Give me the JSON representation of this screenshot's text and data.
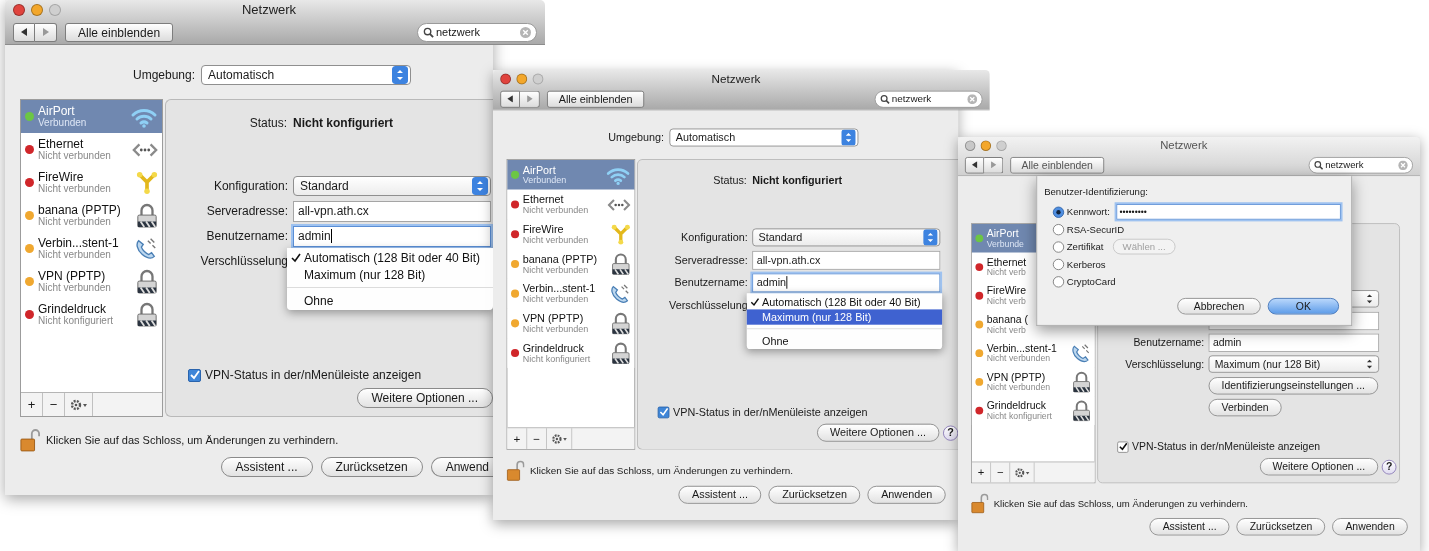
{
  "windows": [
    {
      "title": "Netzwerk",
      "active": true,
      "toolbar": {
        "show_all": "Alle einblenden",
        "search": "netzwerk"
      },
      "location": {
        "label": "Umgebung:",
        "value": "Automatisch"
      },
      "services": [
        {
          "name": "AirPort",
          "status": "Verbunden",
          "color": "#6cc644",
          "kind": "wifi",
          "selected": true
        },
        {
          "name": "Ethernet",
          "status": "Nicht verbunden",
          "color": "#d0262a",
          "kind": "ethernet",
          "selected": false
        },
        {
          "name": "FireWire",
          "status": "Nicht verbunden",
          "color": "#d0262a",
          "kind": "firewire",
          "selected": false
        },
        {
          "name": "banana (PPTP)",
          "status": "Nicht verbunden",
          "color": "#f0a830",
          "kind": "lock",
          "selected": false
        },
        {
          "name": "Verbin...stent-1",
          "status": "Nicht verbunden",
          "color": "#f0a830",
          "kind": "phone",
          "selected": false
        },
        {
          "name": "VPN (PPTP)",
          "status": "Nicht verbunden",
          "color": "#f0a830",
          "kind": "lock",
          "selected": false
        },
        {
          "name": "Grindeldruck",
          "status": "Nicht konfiguriert",
          "color": "#d0262a",
          "kind": "lock",
          "selected": false
        }
      ],
      "list_controls": [
        "+",
        "−"
      ],
      "status": {
        "label": "Status:",
        "value": "Nicht konfiguriert"
      },
      "form": [
        {
          "kind": "popup",
          "label": "Konfiguration:",
          "value": "Standard"
        },
        {
          "kind": "field",
          "label": "Serveradresse:",
          "value": "all-vpn.ath.cx",
          "focused": false
        },
        {
          "kind": "field",
          "label": "Benutzername:",
          "value": "admin",
          "focused": true
        },
        {
          "kind": "menu",
          "label": "Verschlüsselung",
          "options": [
            {
              "label": "Automatisch (128 Bit oder 40 Bit)",
              "checked": true,
              "selected": false,
              "separator_before": false
            },
            {
              "label": "Maximum (nur 128 Bit)",
              "checked": false,
              "selected": false,
              "separator_before": false
            },
            {
              "label": "Ohne",
              "checked": false,
              "selected": false,
              "separator_before": true
            }
          ]
        }
      ],
      "show_status": {
        "label": "VPN-Status in der/nMenüleiste anzeigen",
        "checked": true
      },
      "more_options": "Weitere Optionen ...",
      "lock_text": "Klicken Sie auf das Schloss, um Änderungen zu verhindern.",
      "buttons": [
        "Assistent ...",
        "Zurücksetzen",
        "Anwend"
      ]
    },
    {
      "title": "Netzwerk",
      "active": true,
      "toolbar": {
        "show_all": "Alle einblenden",
        "search": "netzwerk"
      },
      "location": {
        "label": "Umgebung:",
        "value": "Automatisch"
      },
      "services": [
        {
          "name": "AirPort",
          "status": "Verbunden",
          "color": "#6cc644",
          "kind": "wifi",
          "selected": true
        },
        {
          "name": "Ethernet",
          "status": "Nicht verbunden",
          "color": "#d0262a",
          "kind": "ethernet",
          "selected": false
        },
        {
          "name": "FireWire",
          "status": "Nicht verbunden",
          "color": "#d0262a",
          "kind": "firewire",
          "selected": false
        },
        {
          "name": "banana (PPTP)",
          "status": "Nicht verbunden",
          "color": "#f0a830",
          "kind": "lock",
          "selected": false
        },
        {
          "name": "Verbin...stent-1",
          "status": "Nicht verbunden",
          "color": "#f0a830",
          "kind": "phone",
          "selected": false
        },
        {
          "name": "VPN (PPTP)",
          "status": "Nicht verbunden",
          "color": "#f0a830",
          "kind": "lock",
          "selected": false
        },
        {
          "name": "Grindeldruck",
          "status": "Nicht konfiguriert",
          "color": "#d0262a",
          "kind": "lock",
          "selected": false
        }
      ],
      "list_controls": [
        "+",
        "−"
      ],
      "status": {
        "label": "Status:",
        "value": "Nicht konfiguriert"
      },
      "form": [
        {
          "kind": "popup",
          "label": "Konfiguration:",
          "value": "Standard"
        },
        {
          "kind": "field",
          "label": "Serveradresse:",
          "value": "all-vpn.ath.cx",
          "focused": false
        },
        {
          "kind": "field",
          "label": "Benutzername:",
          "value": "admin",
          "focused": true
        },
        {
          "kind": "menu",
          "label": "Verschlüsselung",
          "options": [
            {
              "label": "Automatisch (128 Bit oder 40 Bit)",
              "checked": true,
              "selected": false,
              "separator_before": false
            },
            {
              "label": "Maximum (nur 128 Bit)",
              "checked": false,
              "selected": true,
              "separator_before": false
            },
            {
              "label": "Ohne",
              "checked": false,
              "selected": false,
              "separator_before": true
            }
          ]
        }
      ],
      "show_status": {
        "label": "VPN-Status in der/nMenüleiste anzeigen",
        "checked": true
      },
      "more_options": "Weitere Optionen ...",
      "help": "?",
      "lock_text": "Klicken Sie auf das Schloss, um Änderungen zu verhindern.",
      "buttons": [
        "Assistent ...",
        "Zurücksetzen",
        "Anwenden"
      ]
    },
    {
      "title": "Netzwerk",
      "active": false,
      "toolbar": {
        "show_all": "Alle einblenden",
        "search": "netzwerk"
      },
      "services": [
        {
          "name": "AirPort",
          "status": "Verbunde",
          "color": "#6cc644",
          "selected": true
        },
        {
          "name": "Ethernet",
          "status": "Nicht verb",
          "color": "#d0262a",
          "selected": false
        },
        {
          "name": "FireWire",
          "status": "Nicht verb",
          "color": "#d0262a",
          "selected": false
        },
        {
          "name": "banana (",
          "status": "Nicht verb",
          "color": "#f0a830",
          "selected": false
        },
        {
          "name": "Verbin...stent-1",
          "status": "Nicht verbunden",
          "color": "#f0a830",
          "kind": "phone",
          "selected": false
        },
        {
          "name": "VPN (PPTP)",
          "status": "Nicht verbunden",
          "color": "#f0a830",
          "kind": "lock",
          "selected": false
        },
        {
          "name": "Grindeldruck",
          "status": "Nicht konfiguriert",
          "color": "#d0262a",
          "kind": "lock",
          "selected": false
        }
      ],
      "list_controls": [
        "+",
        "−"
      ],
      "form": [
        {
          "kind": "popup"
        },
        {
          "kind": "field",
          "focused": false
        },
        {
          "kind": "field",
          "label": "Benutzername:",
          "value": "admin",
          "focused": false
        },
        {
          "kind": "popup",
          "label": "Verschlüsselung:",
          "value": "Maximum (nur 128 Bit)"
        },
        {
          "kind": "button",
          "label": "Identifizierungseinstellungen ..."
        },
        {
          "kind": "button",
          "label": "Verbinden"
        }
      ],
      "show_status": {
        "label": "VPN-Status in der/nMenüleiste anzeigen",
        "checked": true
      },
      "more_options": "Weitere Optionen ...",
      "help": "?",
      "lock_text": "Klicken Sie auf das Schloss, um Änderungen zu verhindern.",
      "buttons": [
        "Assistent ...",
        "Zurücksetzen",
        "Anwenden"
      ],
      "sheet": {
        "title": "Benutzer-Identifizierung:",
        "options": [
          {
            "label": "Kennwort:",
            "selected": true,
            "password": "•••••••••",
            "focused": true
          },
          {
            "label": "RSA-SecurID",
            "selected": false
          },
          {
            "label": "Zertifikat",
            "selected": false,
            "button": {
              "label": "Wählen ...",
              "disabled": true
            }
          },
          {
            "label": "Kerberos",
            "selected": false
          },
          {
            "label": "CryptoCard",
            "selected": false
          }
        ],
        "buttons": [
          {
            "label": "Abbrechen",
            "default": false
          },
          {
            "label": "OK",
            "default": true
          }
        ]
      }
    }
  ]
}
